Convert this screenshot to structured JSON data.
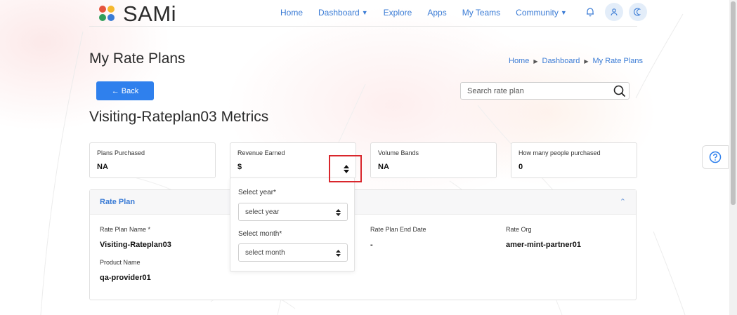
{
  "app": {
    "name": "SAMi"
  },
  "nav": {
    "items": [
      {
        "label": "Home",
        "dropdown": false
      },
      {
        "label": "Dashboard",
        "dropdown": true
      },
      {
        "label": "Explore",
        "dropdown": false
      },
      {
        "label": "Apps",
        "dropdown": false
      },
      {
        "label": "My Teams",
        "dropdown": false
      },
      {
        "label": "Community",
        "dropdown": true
      }
    ],
    "icons": [
      "bell-icon",
      "user-icon",
      "moon-icon"
    ]
  },
  "page": {
    "title": "My Rate Plans",
    "breadcrumb": [
      "Home",
      "Dashboard",
      "My Rate Plans"
    ],
    "back_label": "← Back",
    "search_placeholder": "Search rate plan",
    "metrics_title": "Visiting-Rateplan03 Metrics"
  },
  "cards": [
    {
      "label": "Plans Purchased",
      "value": "NA"
    },
    {
      "label": "Revenue Earned",
      "value": "$"
    },
    {
      "label": "Volume Bands",
      "value": "NA"
    },
    {
      "label": "How many people purchased",
      "value": "0"
    }
  ],
  "popover": {
    "year_label": "Select year*",
    "year_placeholder": "select year",
    "month_label": "Select month*",
    "month_placeholder": "select month"
  },
  "rate_plan": {
    "section_title": "Rate Plan",
    "fields": [
      {
        "label": "Rate Plan Name *",
        "value": "Visiting-Rateplan03"
      },
      {
        "label": "Rate Plan End Date",
        "value": "-"
      },
      {
        "label": "Rate Org",
        "value": "amer-mint-partner01"
      },
      {
        "label": "Product Name",
        "value": "qa-provider01"
      }
    ]
  },
  "colors": {
    "accent": "#3a7bd5",
    "primary_button": "#2f80ed",
    "highlight": "#d9262c",
    "logo_dots": [
      "#e5533d",
      "#f5b82e",
      "#2f9e5a",
      "#3a7bd5"
    ]
  }
}
